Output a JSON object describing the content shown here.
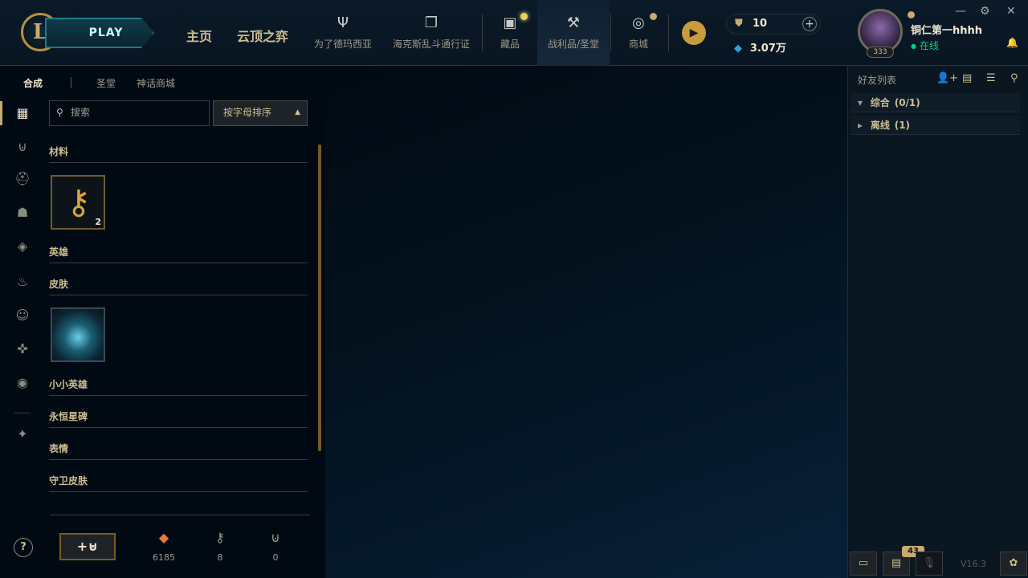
{
  "header": {
    "play_label": "PLAY",
    "nav_main": [
      "主页",
      "云顶之弈"
    ],
    "nav_items": [
      {
        "label": "为了德玛西亚",
        "icon": "trident-icon"
      },
      {
        "label": "海克斯乱斗通行证",
        "icon": "pass-cards-icon"
      },
      {
        "label": "藏品",
        "icon": "collection-bag-icon"
      },
      {
        "label": "战利品/圣堂",
        "icon": "loot-hammer-icon"
      },
      {
        "label": "商城",
        "icon": "store-coins-icon"
      }
    ],
    "rp_value": "10",
    "be_value": "3.07万",
    "profile": {
      "name": "铜仁第一hhhh",
      "status": "在线",
      "level": "333"
    }
  },
  "subtabs": [
    "合成",
    "圣堂",
    "神话商城"
  ],
  "search": {
    "placeholder": "搜索"
  },
  "sort": {
    "label": "按字母排序"
  },
  "categories": [
    "材料",
    "英雄",
    "皮肤",
    "小小英雄",
    "永恒星碑",
    "表情",
    "守卫皮肤"
  ],
  "material_tile": {
    "count": "2",
    "icon": "hextech-key-icon"
  },
  "resources": [
    {
      "icon": "orange-essence-icon",
      "value": "6185"
    },
    {
      "icon": "key-fragment-icon",
      "value": "8"
    },
    {
      "icon": "mythic-essence-icon",
      "value": "0"
    }
  ],
  "friends": {
    "title": "好友列表",
    "groups": [
      {
        "label": "综合",
        "count": "(0/1)"
      },
      {
        "label": "离线",
        "count": "(1)"
      }
    ]
  },
  "footer": {
    "messages_badge": "43",
    "version": "V16.3"
  },
  "colors": {
    "gold": "#c8aa6e",
    "teal": "#1e7b87",
    "online": "#0acf83",
    "background": "#010a13"
  }
}
